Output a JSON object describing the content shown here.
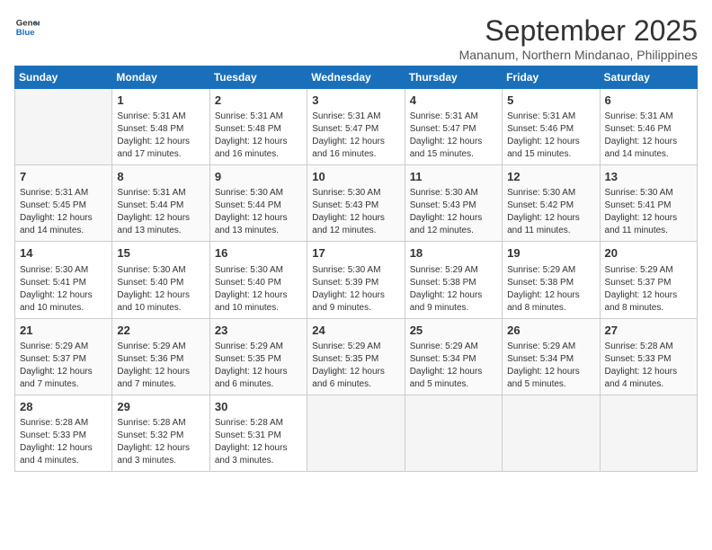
{
  "logo": {
    "line1": "General",
    "line2": "Blue"
  },
  "title": "September 2025",
  "subtitle": "Mananum, Northern Mindanao, Philippines",
  "days_of_week": [
    "Sunday",
    "Monday",
    "Tuesday",
    "Wednesday",
    "Thursday",
    "Friday",
    "Saturday"
  ],
  "weeks": [
    [
      {
        "day": "",
        "info": ""
      },
      {
        "day": "1",
        "info": "Sunrise: 5:31 AM\nSunset: 5:48 PM\nDaylight: 12 hours\nand 17 minutes."
      },
      {
        "day": "2",
        "info": "Sunrise: 5:31 AM\nSunset: 5:48 PM\nDaylight: 12 hours\nand 16 minutes."
      },
      {
        "day": "3",
        "info": "Sunrise: 5:31 AM\nSunset: 5:47 PM\nDaylight: 12 hours\nand 16 minutes."
      },
      {
        "day": "4",
        "info": "Sunrise: 5:31 AM\nSunset: 5:47 PM\nDaylight: 12 hours\nand 15 minutes."
      },
      {
        "day": "5",
        "info": "Sunrise: 5:31 AM\nSunset: 5:46 PM\nDaylight: 12 hours\nand 15 minutes."
      },
      {
        "day": "6",
        "info": "Sunrise: 5:31 AM\nSunset: 5:46 PM\nDaylight: 12 hours\nand 14 minutes."
      }
    ],
    [
      {
        "day": "7",
        "info": "Sunrise: 5:31 AM\nSunset: 5:45 PM\nDaylight: 12 hours\nand 14 minutes."
      },
      {
        "day": "8",
        "info": "Sunrise: 5:31 AM\nSunset: 5:44 PM\nDaylight: 12 hours\nand 13 minutes."
      },
      {
        "day": "9",
        "info": "Sunrise: 5:30 AM\nSunset: 5:44 PM\nDaylight: 12 hours\nand 13 minutes."
      },
      {
        "day": "10",
        "info": "Sunrise: 5:30 AM\nSunset: 5:43 PM\nDaylight: 12 hours\nand 12 minutes."
      },
      {
        "day": "11",
        "info": "Sunrise: 5:30 AM\nSunset: 5:43 PM\nDaylight: 12 hours\nand 12 minutes."
      },
      {
        "day": "12",
        "info": "Sunrise: 5:30 AM\nSunset: 5:42 PM\nDaylight: 12 hours\nand 11 minutes."
      },
      {
        "day": "13",
        "info": "Sunrise: 5:30 AM\nSunset: 5:41 PM\nDaylight: 12 hours\nand 11 minutes."
      }
    ],
    [
      {
        "day": "14",
        "info": "Sunrise: 5:30 AM\nSunset: 5:41 PM\nDaylight: 12 hours\nand 10 minutes."
      },
      {
        "day": "15",
        "info": "Sunrise: 5:30 AM\nSunset: 5:40 PM\nDaylight: 12 hours\nand 10 minutes."
      },
      {
        "day": "16",
        "info": "Sunrise: 5:30 AM\nSunset: 5:40 PM\nDaylight: 12 hours\nand 10 minutes."
      },
      {
        "day": "17",
        "info": "Sunrise: 5:30 AM\nSunset: 5:39 PM\nDaylight: 12 hours\nand 9 minutes."
      },
      {
        "day": "18",
        "info": "Sunrise: 5:29 AM\nSunset: 5:38 PM\nDaylight: 12 hours\nand 9 minutes."
      },
      {
        "day": "19",
        "info": "Sunrise: 5:29 AM\nSunset: 5:38 PM\nDaylight: 12 hours\nand 8 minutes."
      },
      {
        "day": "20",
        "info": "Sunrise: 5:29 AM\nSunset: 5:37 PM\nDaylight: 12 hours\nand 8 minutes."
      }
    ],
    [
      {
        "day": "21",
        "info": "Sunrise: 5:29 AM\nSunset: 5:37 PM\nDaylight: 12 hours\nand 7 minutes."
      },
      {
        "day": "22",
        "info": "Sunrise: 5:29 AM\nSunset: 5:36 PM\nDaylight: 12 hours\nand 7 minutes."
      },
      {
        "day": "23",
        "info": "Sunrise: 5:29 AM\nSunset: 5:35 PM\nDaylight: 12 hours\nand 6 minutes."
      },
      {
        "day": "24",
        "info": "Sunrise: 5:29 AM\nSunset: 5:35 PM\nDaylight: 12 hours\nand 6 minutes."
      },
      {
        "day": "25",
        "info": "Sunrise: 5:29 AM\nSunset: 5:34 PM\nDaylight: 12 hours\nand 5 minutes."
      },
      {
        "day": "26",
        "info": "Sunrise: 5:29 AM\nSunset: 5:34 PM\nDaylight: 12 hours\nand 5 minutes."
      },
      {
        "day": "27",
        "info": "Sunrise: 5:28 AM\nSunset: 5:33 PM\nDaylight: 12 hours\nand 4 minutes."
      }
    ],
    [
      {
        "day": "28",
        "info": "Sunrise: 5:28 AM\nSunset: 5:33 PM\nDaylight: 12 hours\nand 4 minutes."
      },
      {
        "day": "29",
        "info": "Sunrise: 5:28 AM\nSunset: 5:32 PM\nDaylight: 12 hours\nand 3 minutes."
      },
      {
        "day": "30",
        "info": "Sunrise: 5:28 AM\nSunset: 5:31 PM\nDaylight: 12 hours\nand 3 minutes."
      },
      {
        "day": "",
        "info": ""
      },
      {
        "day": "",
        "info": ""
      },
      {
        "day": "",
        "info": ""
      },
      {
        "day": "",
        "info": ""
      }
    ]
  ]
}
